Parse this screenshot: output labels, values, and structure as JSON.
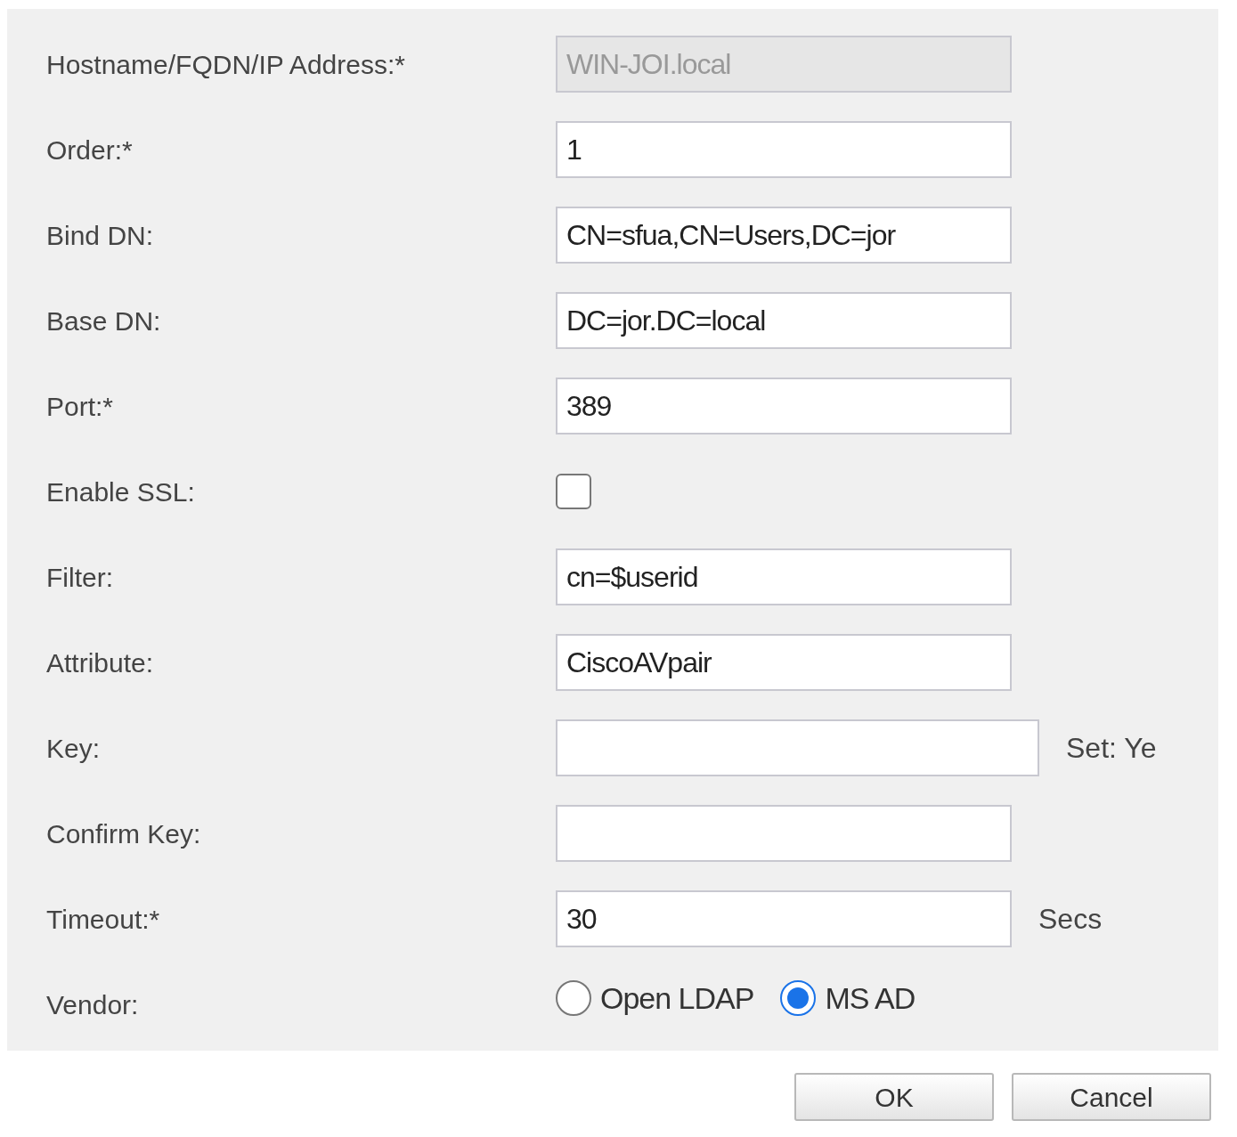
{
  "fields": [
    {
      "kind": "text",
      "label": "Hostname/FQDN/IP Address:*",
      "value": "WIN-JOI.local",
      "disabled": true
    },
    {
      "kind": "text",
      "label": "Order:*",
      "value": "1",
      "disabled": false
    },
    {
      "kind": "text",
      "label": "Bind DN:",
      "value": "CN=sfua,CN=Users,DC=jor",
      "disabled": false
    },
    {
      "kind": "text",
      "label": "Base DN:",
      "value": "DC=jor.DC=local",
      "disabled": false
    },
    {
      "kind": "text",
      "label": "Port:*",
      "value": "389",
      "disabled": false
    },
    {
      "kind": "checkbox",
      "label": "Enable SSL:",
      "checked": false
    },
    {
      "kind": "text",
      "label": "Filter:",
      "value": "cn=$userid",
      "disabled": false
    },
    {
      "kind": "text",
      "label": "Attribute:",
      "value": "CiscoAVpair",
      "disabled": false
    },
    {
      "kind": "wide_text",
      "label": "Key:",
      "disabled": false,
      "suffix": "Set: Ye"
    },
    {
      "kind": "text",
      "label": "Confirm Key:",
      "disabled": false
    },
    {
      "kind": "text",
      "label": "Timeout:*",
      "value": "30",
      "disabled": false,
      "suffix": "Secs"
    },
    {
      "kind": "radio",
      "label": "Vendor:",
      "options": [
        {
          "label": "Open LDAP",
          "selected": false
        },
        {
          "label": "MS AD",
          "selected": true
        }
      ]
    }
  ],
  "buttons": [
    "OK",
    "Cancel"
  ]
}
